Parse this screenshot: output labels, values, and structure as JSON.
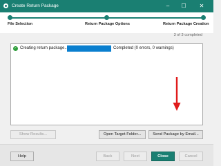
{
  "window": {
    "title": "Create Return Package",
    "minimize": "–",
    "maximize": "☐",
    "close": "✕"
  },
  "steps": [
    {
      "label": "File Selection"
    },
    {
      "label": "Return Package Options"
    },
    {
      "label": "Return Package Creation"
    }
  ],
  "progress_count": "3 of 3 completed",
  "task": {
    "label": "Creating return package...",
    "status": "Completed (0 errors, 0 warnings)",
    "progress": 1.0
  },
  "buttons": {
    "show_results": "Show Results...",
    "open_target": "Open Target Folder...",
    "send_email": "Send Package by Email...",
    "help": "Help",
    "back": "Back",
    "next": "Next",
    "close": "Close",
    "cancel": "Cancel"
  },
  "colors": {
    "accent": "#1a7f72",
    "progress": "#0a7fcf",
    "success": "#2e9e3a",
    "annotation_arrow": "#e01b1b"
  }
}
